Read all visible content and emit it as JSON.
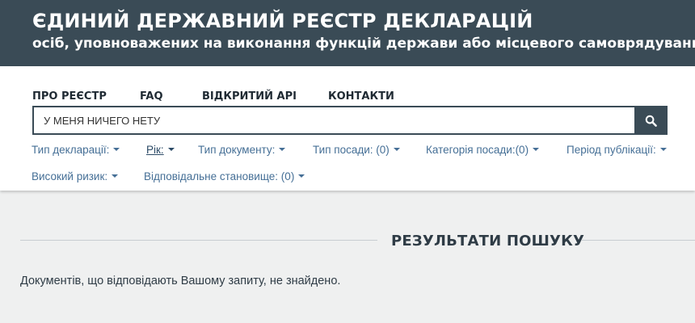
{
  "header": {
    "title": "ЄДИНИЙ ДЕРЖАВНИЙ РЕЄСТР ДЕКЛАРАЦІЙ",
    "subtitle": "осіб, уповноважених на виконання функцій держави або місцевого самоврядування"
  },
  "nav": {
    "items": [
      {
        "label": "ПРО РЕЄСТР"
      },
      {
        "label": "FAQ"
      },
      {
        "label": "ВІДКРИТИЙ API"
      },
      {
        "label": "КОНТАКТИ"
      }
    ]
  },
  "search": {
    "value": "У МЕНЯ НИЧЕГО НЕТУ",
    "button_icon": "search-icon"
  },
  "filters": {
    "items": [
      {
        "label": "Тип декларації:",
        "active": false
      },
      {
        "label": "Рік:",
        "active": true
      },
      {
        "label": "Тип документу:",
        "active": false
      },
      {
        "label": "Тип посади: (0)",
        "active": false
      },
      {
        "label": "Категорія посади:(0)",
        "active": false
      },
      {
        "label": "Період публікації:",
        "active": false
      },
      {
        "label": "Високий ризик:",
        "active": false
      },
      {
        "label": "Відповідальне становище: (0)",
        "active": false
      }
    ]
  },
  "results": {
    "title": "РЕЗУЛЬТАТИ ПОШУКУ",
    "message": "Документів, що відповідають Вашому запиту, не знайдено."
  },
  "colors": {
    "header_bg": "#3a4b56",
    "link": "#456f96",
    "page_bg": "#eff0f0"
  }
}
